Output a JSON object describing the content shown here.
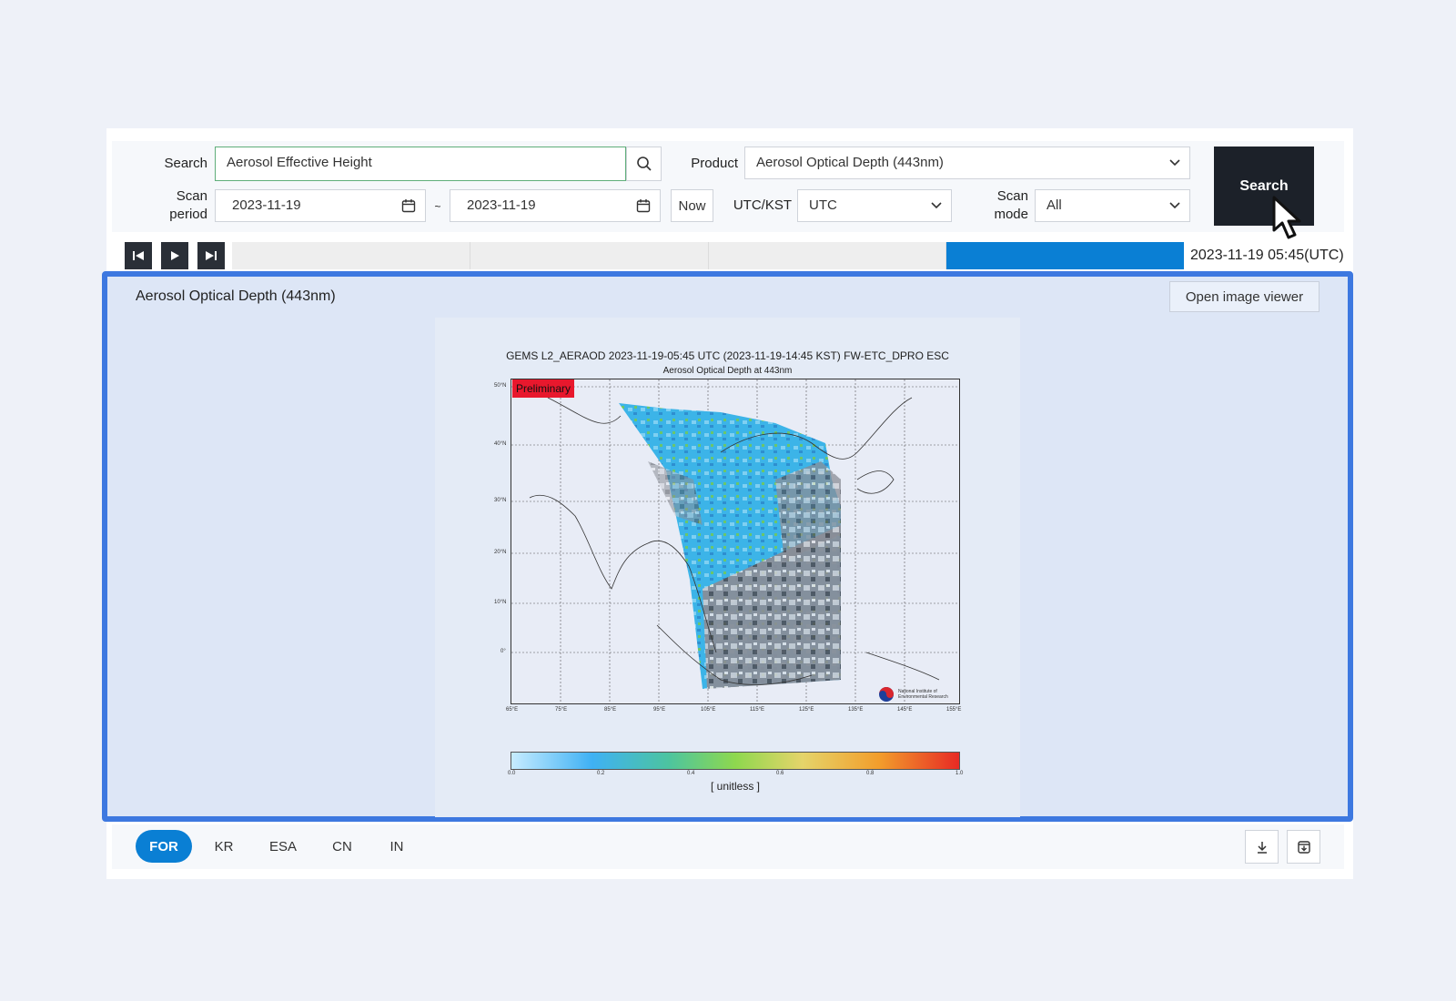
{
  "form": {
    "search_label": "Search",
    "search_value": "Aerosol Effective Height",
    "product_label": "Product",
    "product_value": "Aerosol Optical Depth (443nm)",
    "scan_period_label_1": "Scan",
    "scan_period_label_2": "period",
    "date_from": "2023-11-19",
    "date_sep": "~",
    "date_to": "2023-11-19",
    "now_label": "Now",
    "tz_label": "UTC/KST",
    "tz_value": "UTC",
    "scan_mode_label_1": "Scan",
    "scan_mode_label_2": "mode",
    "scan_mode_value": "All",
    "search_button": "Search"
  },
  "timeline": {
    "segments": 4,
    "active_segment": 4,
    "current_time": "2023-11-19 05:45(UTC)"
  },
  "panel": {
    "title": "Aerosol Optical Depth (443nm)",
    "viewer_button": "Open image viewer"
  },
  "figure": {
    "title": "GEMS L2_AERAOD 2023-11-19-05:45 UTC (2023-11-19-14:45 KST)  FW-ETC_DPRO ESC",
    "subtitle": "Aerosol Optical Depth at 443nm",
    "badge": "Preliminary",
    "lat_labels": [
      "50°N",
      "40°N",
      "30°N",
      "20°N",
      "10°N",
      "0°"
    ],
    "lon_labels": [
      "65°E",
      "75°E",
      "85°E",
      "95°E",
      "105°E",
      "115°E",
      "125°E",
      "135°E",
      "145°E",
      "155°E"
    ],
    "institute_line1": "National Institute of",
    "institute_line2": "Environmental Research",
    "colorbar_ticks": [
      "0.0",
      "0.2",
      "0.4",
      "0.6",
      "0.8",
      "1.0"
    ],
    "colorbar_label": "[ unitless ]"
  },
  "tabs": [
    {
      "label": "FOR",
      "active": true
    },
    {
      "label": "KR",
      "active": false
    },
    {
      "label": "ESA",
      "active": false
    },
    {
      "label": "CN",
      "active": false
    },
    {
      "label": "IN",
      "active": false
    }
  ],
  "colors": {
    "accent": "#0a7fd4",
    "panel_border": "#3d78e0",
    "search_button_bg": "#1c2129",
    "preliminary_badge": "#e8182d"
  },
  "icons": {
    "search": "magnifier-icon",
    "calendar": "calendar-icon",
    "dropdown": "chevron-down-icon",
    "first": "skip-back-icon",
    "play": "play-icon",
    "last": "skip-forward-icon",
    "download": "download-icon",
    "archive": "archive-download-icon",
    "cursor": "mouse-pointer-icon"
  }
}
